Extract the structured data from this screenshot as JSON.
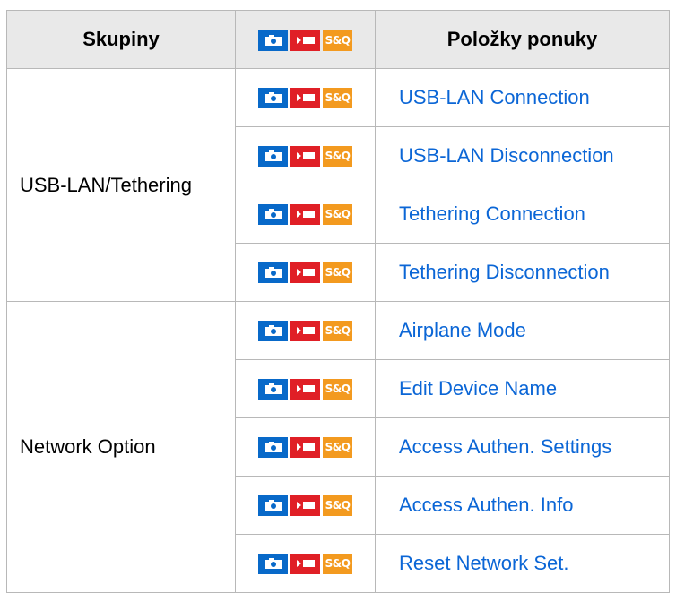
{
  "header": {
    "col_group": "Skupiny",
    "col_items": "Položky ponuky",
    "mode_icons": [
      "camera-icon",
      "movie-icon",
      "sq-icon"
    ],
    "sq_label": "S&Q"
  },
  "groups": [
    {
      "name": "USB-LAN/Tethering",
      "items": [
        "USB-LAN Connection",
        "USB-LAN Disconnection",
        "Tethering Connection",
        "Tethering Disconnection"
      ]
    },
    {
      "name": "Network Option",
      "items": [
        "Airplane Mode",
        "Edit Device Name",
        "Access Authen. Settings",
        "Access Authen. Info",
        "Reset Network Set."
      ]
    }
  ],
  "colors": {
    "photo": "#0869c9",
    "movie": "#e01f26",
    "sq": "#f39a1f",
    "link": "#0b66d6",
    "header_bg": "#e9e9e9",
    "border": "#b8b8b8"
  }
}
